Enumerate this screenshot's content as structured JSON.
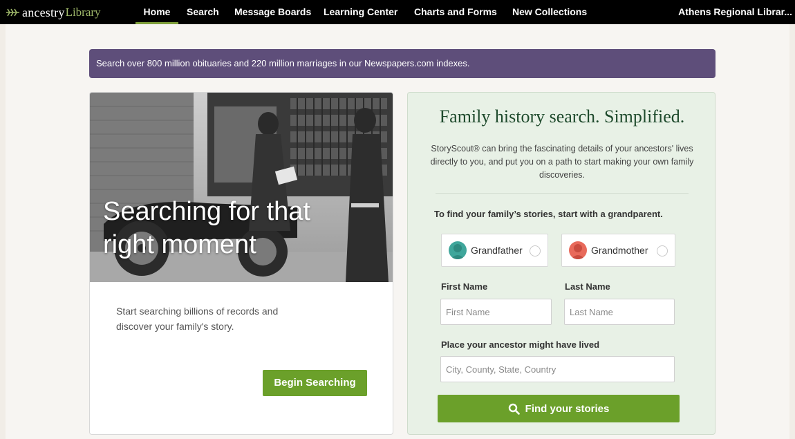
{
  "brand": {
    "name": "ancestry",
    "suffix": "Library"
  },
  "nav": {
    "items": [
      {
        "label": "Home",
        "active": true
      },
      {
        "label": "Search"
      },
      {
        "label": "Message Boards"
      },
      {
        "label": "Learning Center"
      },
      {
        "label": "Charts and Forms"
      },
      {
        "label": "New Collections"
      }
    ],
    "account": "Athens Regional Librar..."
  },
  "banner": {
    "text": "Search over 800 million obituaries and 220 million marriages in our Newspapers.com indexes."
  },
  "left_card": {
    "hero_title": "Searching for that right moment",
    "description": "Start searching billions of records and discover your family's story.",
    "button": "Begin Searching"
  },
  "right_card": {
    "title": "Family history search. Simplified.",
    "description": "StoryScout® can bring the fascinating details of your ancestors' lives directly to you, and put you on a path to start making your own family discoveries.",
    "prompt": "To find your family’s stories, start with a grandparent.",
    "grandfather": "Grandfather",
    "grandmother": "Grandmother",
    "first_name_label": "First Name",
    "first_name_placeholder": "First Name",
    "last_name_label": "Last Name",
    "last_name_placeholder": "Last Name",
    "place_label": "Place your ancestor might have lived",
    "place_placeholder": "City, County, State, Country",
    "button": "Find your stories"
  },
  "colors": {
    "accent_green": "#6ba02a",
    "banner_purple": "#5e4e7a",
    "panel_green": "#e8f1e6"
  }
}
